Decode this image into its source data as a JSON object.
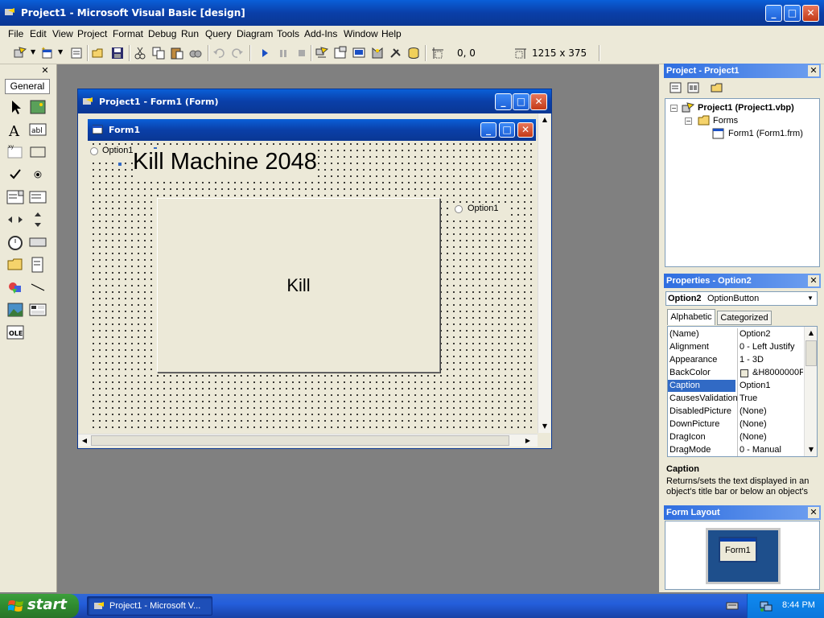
{
  "app": {
    "title": "Project1 - Microsoft Visual Basic [design]"
  },
  "menu": [
    "File",
    "Edit",
    "View",
    "Project",
    "Format",
    "Debug",
    "Run",
    "Query",
    "Diagram",
    "Tools",
    "Add-Ins",
    "Window",
    "Help"
  ],
  "toolbar": {
    "position": "0, 0",
    "size": "1215 x 375"
  },
  "toolbox": {
    "tab_label": "General"
  },
  "designer": {
    "title": "Project1 - Form1 (Form)",
    "form_title": "Form1",
    "heading": "Kill Machine 2048",
    "button_caption": "Kill",
    "option_left": "Option1",
    "option_right": "Option1"
  },
  "project_panel": {
    "title": "Project - Project1",
    "root": "Project1 (Project1.vbp)",
    "folder": "Forms",
    "item": "Form1 (Form1.frm)"
  },
  "properties_panel": {
    "title": "Properties - Option2",
    "object_name": "Option2",
    "object_type": "OptionButton",
    "tabs": [
      "Alphabetic",
      "Categorized"
    ],
    "rows": [
      {
        "name": "(Name)",
        "value": "Option2"
      },
      {
        "name": "Alignment",
        "value": "0 - Left Justify"
      },
      {
        "name": "Appearance",
        "value": "1 - 3D"
      },
      {
        "name": "BackColor",
        "value": "&H8000000F"
      },
      {
        "name": "Caption",
        "value": "Option1"
      },
      {
        "name": "CausesValidation",
        "value": "True"
      },
      {
        "name": "DisabledPicture",
        "value": "(None)"
      },
      {
        "name": "DownPicture",
        "value": "(None)"
      },
      {
        "name": "DragIcon",
        "value": "(None)"
      },
      {
        "name": "DragMode",
        "value": "0 - Manual"
      }
    ],
    "desc_title": "Caption",
    "desc_text": "Returns/sets the text displayed in an object's title bar or below an object's"
  },
  "form_layout": {
    "title": "Form Layout",
    "preview_label": "Form1"
  },
  "taskbar": {
    "start": "start",
    "task": "Project1 - Microsoft V...",
    "time": "8:44 PM"
  },
  "colors": {
    "title_blue": "#0a3fa8",
    "xp_green": "#2f8a2f",
    "selection_blue": "#316ac5"
  }
}
